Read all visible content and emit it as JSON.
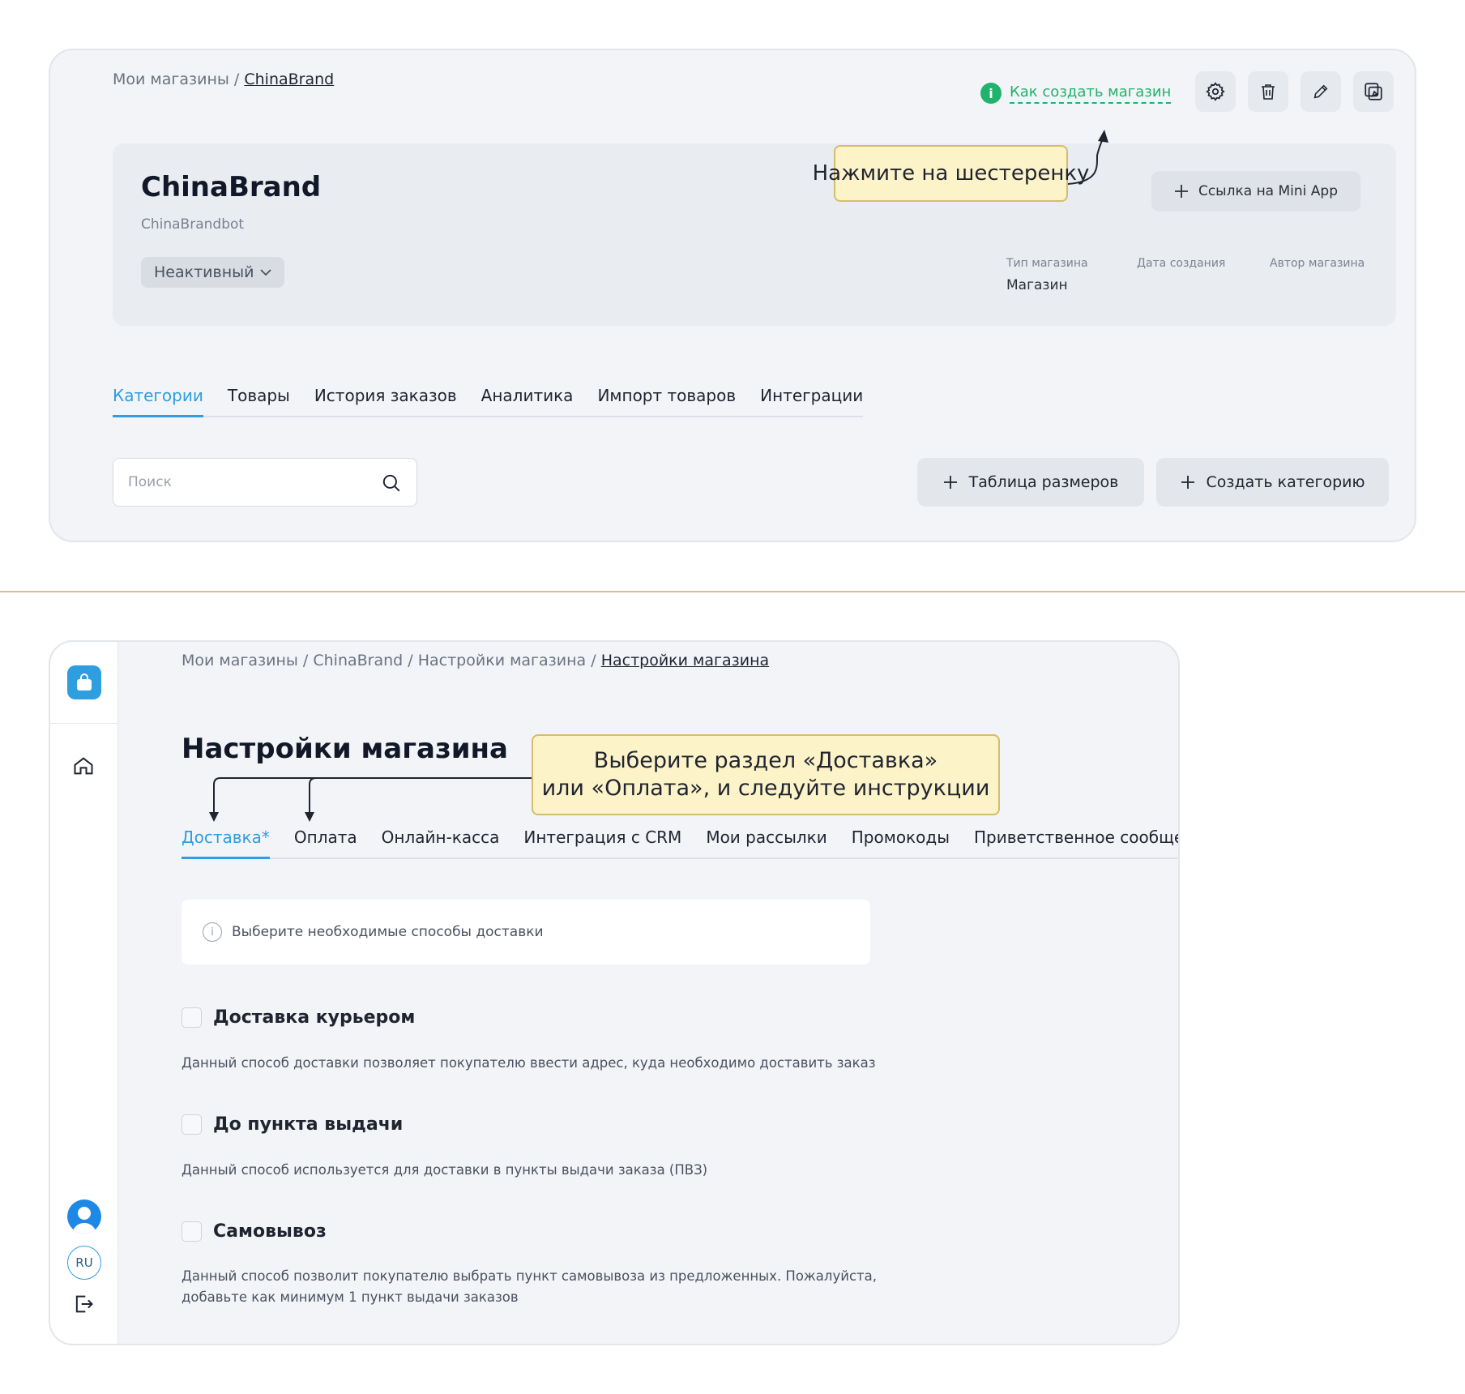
{
  "top": {
    "breadcrumb": {
      "root": "Мои магазины",
      "sep": " / ",
      "current": "ChinaBrand"
    },
    "help_link": "Как создать магазин",
    "toolbar_icons": [
      "gear-icon",
      "trash-icon",
      "pencil-icon",
      "copy-icon"
    ],
    "callout": "Нажмите на шестеренку",
    "store": {
      "name": "ChinaBrand",
      "bot": "ChinaBrandbot",
      "status": "Неактивный",
      "miniapp_button": "Ссылка на Mini App",
      "meta": [
        {
          "label": "Тип магазина",
          "value": "Магазин"
        },
        {
          "label": "Дата создания",
          "value": ""
        },
        {
          "label": "Автор магазина",
          "value": ""
        }
      ]
    },
    "tabs": [
      "Категории",
      "Товары",
      "История заказов",
      "Аналитика",
      "Импорт товаров",
      "Интеграции"
    ],
    "active_tab": 0,
    "search_placeholder": "Поиск",
    "size_table_button": "Таблица размеров",
    "create_category_button": "Создать категорию"
  },
  "bottom": {
    "breadcrumb": {
      "part1": "Мои магазины",
      "part2": "ChinaBrand",
      "part3": "Настройки магазина",
      "current": "Настройки магазина",
      "sep": " / "
    },
    "title": "Настройки магазина",
    "callout_line1": "Выберите раздел «Доставка»",
    "callout_line2": "или «Оплата», и следуйте инструкции",
    "tabs": [
      "Доставка*",
      "Оплата",
      "Онлайн-касса",
      "Интеграция с CRM",
      "Мои рассылки",
      "Промокоды",
      "Приветственное сообщение"
    ],
    "active_tab": 0,
    "info": "Выберите необходимые способы доставки",
    "options": [
      {
        "label": "Доставка курьером",
        "checked": false,
        "desc": "Данный способ доставки позволяет покупателю ввести адрес, куда необходимо доставить заказ"
      },
      {
        "label": "До пункта выдачи",
        "checked": false,
        "desc": "Данный способ используется для доставки в пункты выдачи заказа (ПВЗ)"
      },
      {
        "label": "Самовывоз",
        "checked": false,
        "desc": "Данный способ позволит покупателю выбрать пункт самовывоза из предложенных. Пожалуйста, добавьте как минимум 1 пункт выдачи заказов"
      }
    ],
    "sidebar": {
      "language": "RU"
    }
  },
  "colors": {
    "accent": "#2d9ee0",
    "success": "#1fb36b",
    "callout_bg": "#fdf3c8"
  }
}
